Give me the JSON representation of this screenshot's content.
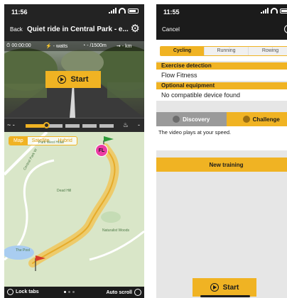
{
  "left": {
    "status_time": "11:56",
    "nav": {
      "back": "Back",
      "title": "Quiet ride in Central Park - e..."
    },
    "stats": {
      "time": "00:00:00",
      "power": "- watts",
      "cadence": "- /1500m",
      "speed": "- km"
    },
    "start": "Start",
    "profile": {
      "left_symbol": "~ -",
      "right_symbol": "-"
    },
    "map": {
      "toggle": [
        "Map",
        "Satellite",
        "Hybrid"
      ],
      "labels": {
        "central_park_west": "Central Park W",
        "dead_hill": "Dead Hill",
        "pool": "The Pool",
        "naturalist": "Naturalist Woods",
        "park_hotel": "Park West Hotel"
      },
      "marker": "FL"
    },
    "bottom": {
      "lock": "Lock tabs",
      "autoscroll": "Auto scroll"
    }
  },
  "right": {
    "status_time": "11:55",
    "nav": {
      "cancel": "Cancel",
      "info": "i"
    },
    "sport_tabs": [
      "Cycling",
      "Running",
      "Rowing"
    ],
    "sections": {
      "exercise_head": "Exercise detection",
      "exercise_value": "Flow Fitness",
      "optional_head": "Optional equipment",
      "optional_value": "No compatible device found"
    },
    "modes": [
      "Discovery",
      "Challenge"
    ],
    "description": "The video plays at your speed.",
    "new_training": "New training",
    "start": "Start"
  },
  "colors": {
    "accent": "#f0b323",
    "dark": "#1b1b1b",
    "marker": "#ec3ca4"
  }
}
